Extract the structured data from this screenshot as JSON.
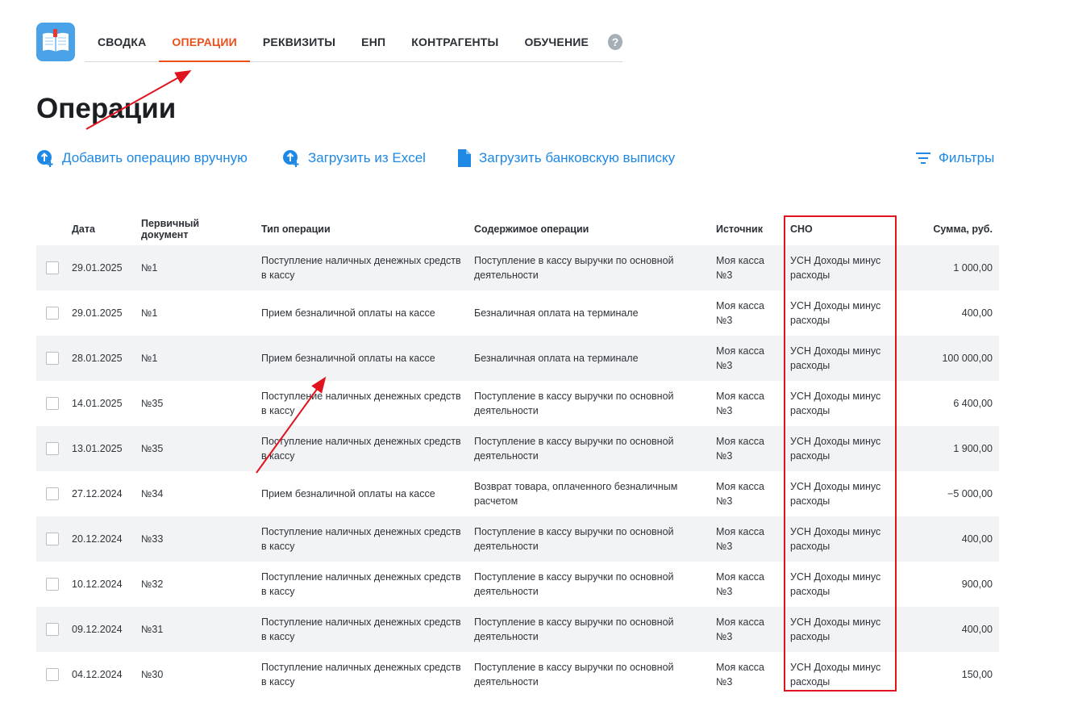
{
  "nav": {
    "items": [
      {
        "label": "СВОДКА",
        "active": false
      },
      {
        "label": "ОПЕРАЦИИ",
        "active": true
      },
      {
        "label": "РЕКВИЗИТЫ",
        "active": false
      },
      {
        "label": "ЕНП",
        "active": false
      },
      {
        "label": "КОНТРАГЕНТЫ",
        "active": false
      },
      {
        "label": "ОБУЧЕНИЕ",
        "active": false
      }
    ],
    "help": "?"
  },
  "page": {
    "title": "Операции"
  },
  "actions": {
    "add_manual": "Добавить операцию вручную",
    "upload_excel": "Загрузить из Excel",
    "upload_bank": "Загрузить банковскую выписку",
    "filters": "Фильтры"
  },
  "table": {
    "headers": {
      "date": "Дата",
      "doc": "Первичный документ",
      "type": "Тип операции",
      "content": "Содержимое операции",
      "source": "Источник",
      "sno": "СНО",
      "sum": "Сумма, руб."
    },
    "rows": [
      {
        "date": "29.01.2025",
        "doc": "№1",
        "type": "Поступление наличных денежных средств в кассу",
        "content": "Поступление в кассу выручки по основной деятельности",
        "source": "Моя касса №3",
        "sno": "УСН Доходы минус расходы",
        "sum": "1 000,00"
      },
      {
        "date": "29.01.2025",
        "doc": "№1",
        "type": "Прием безналичной оплаты на кассе",
        "content": "Безналичная оплата на терминале",
        "source": "Моя касса №3",
        "sno": "УСН Доходы минус расходы",
        "sum": "400,00"
      },
      {
        "date": "28.01.2025",
        "doc": "№1",
        "type": "Прием безналичной оплаты на кассе",
        "content": "Безналичная оплата на терминале",
        "source": "Моя касса №3",
        "sno": "УСН Доходы минус расходы",
        "sum": "100 000,00"
      },
      {
        "date": "14.01.2025",
        "doc": "№35",
        "type": "Поступление наличных денежных средств в кассу",
        "content": "Поступление в кассу выручки по основной деятельности",
        "source": "Моя касса №3",
        "sno": "УСН Доходы минус расходы",
        "sum": "6 400,00"
      },
      {
        "date": "13.01.2025",
        "doc": "№35",
        "type": "Поступление наличных денежных средств в кассу",
        "content": "Поступление в кассу выручки по основной деятельности",
        "source": "Моя касса №3",
        "sno": "УСН Доходы минус расходы",
        "sum": "1 900,00"
      },
      {
        "date": "27.12.2024",
        "doc": "№34",
        "type": "Прием безналичной оплаты на кассе",
        "content": "Возврат товара, оплаченного безналичным расчетом",
        "source": "Моя касса №3",
        "sno": "УСН Доходы минус расходы",
        "sum": "−5 000,00"
      },
      {
        "date": "20.12.2024",
        "doc": "№33",
        "type": "Поступление наличных денежных средств в кассу",
        "content": "Поступление в кассу выручки по основной деятельности",
        "source": "Моя касса №3",
        "sno": "УСН Доходы минус расходы",
        "sum": "400,00"
      },
      {
        "date": "10.12.2024",
        "doc": "№32",
        "type": "Поступление наличных денежных средств в кассу",
        "content": "Поступление в кассу выручки по основной деятельности",
        "source": "Моя касса №3",
        "sno": "УСН Доходы минус расходы",
        "sum": "900,00"
      },
      {
        "date": "09.12.2024",
        "doc": "№31",
        "type": "Поступление наличных денежных средств в кассу",
        "content": "Поступление в кассу выручки по основной деятельности",
        "source": "Моя касса №3",
        "sno": "УСН Доходы минус расходы",
        "sum": "400,00"
      },
      {
        "date": "04.12.2024",
        "doc": "№30",
        "type": "Поступление наличных денежных средств в кассу",
        "content": "Поступление в кассу выручки по основной деятельности",
        "source": "Моя касса №3",
        "sno": "УСН Доходы минус расходы",
        "sum": "150,00"
      }
    ]
  },
  "colors": {
    "accent": "#e8511a",
    "link": "#1e88e5",
    "annotation": "#e0141e",
    "row_alt": "#f2f3f5"
  }
}
